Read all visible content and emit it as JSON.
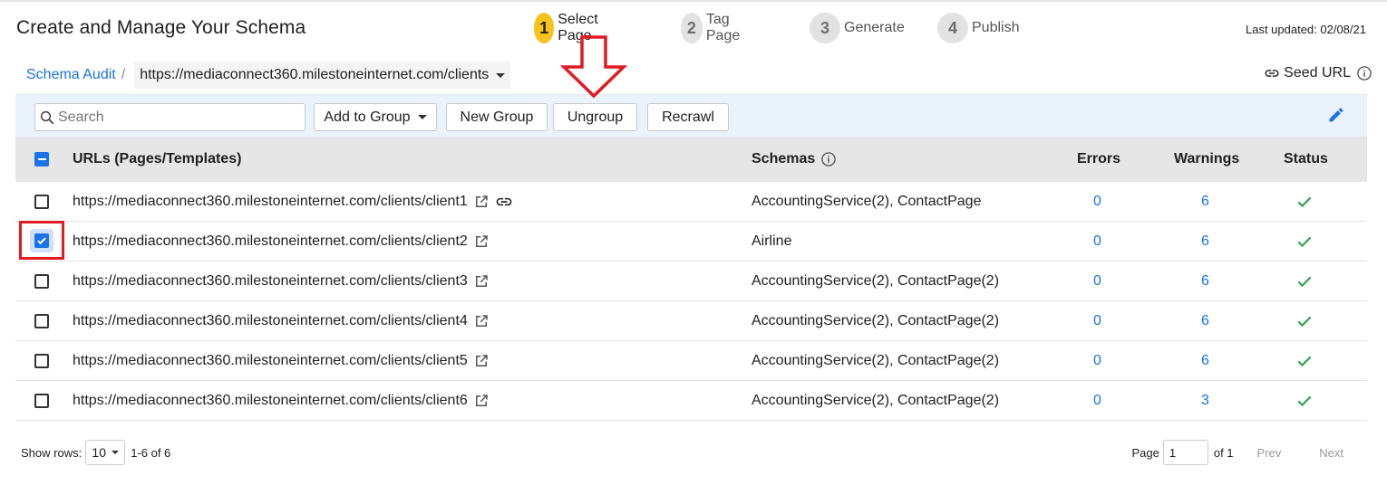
{
  "page": {
    "title": "Create and Manage Your Schema",
    "last_updated": "Last updated: 02/08/21"
  },
  "stepper": [
    {
      "num": "1",
      "label": "Select Page",
      "active": true
    },
    {
      "num": "2",
      "label": "Tag Page",
      "active": false
    },
    {
      "num": "3",
      "label": "Generate",
      "active": false
    },
    {
      "num": "4",
      "label": "Publish",
      "active": false
    }
  ],
  "breadcrumb": {
    "root": "Schema Audit",
    "separator": "/",
    "current_url": "https://mediaconnect360.milestoneinternet.com/clients"
  },
  "seed_url": {
    "label": "Seed URL"
  },
  "toolbar": {
    "search_placeholder": "Search",
    "add_to_group": "Add to Group",
    "new_group": "New Group",
    "ungroup": "Ungroup",
    "recrawl": "Recrawl"
  },
  "table": {
    "headers": {
      "urls": "URLs (Pages/Templates)",
      "schemas": "Schemas",
      "errors": "Errors",
      "warnings": "Warnings",
      "status": "Status"
    },
    "rows": [
      {
        "url": "https://mediaconnect360.milestoneinternet.com/clients/client1",
        "schemas": "AccountingService(2), ContactPage",
        "errors": "0",
        "warnings": "6",
        "checked": false,
        "seed": true,
        "status": "ok"
      },
      {
        "url": "https://mediaconnect360.milestoneinternet.com/clients/client2",
        "schemas": "Airline",
        "errors": "0",
        "warnings": "6",
        "checked": true,
        "seed": false,
        "status": "ok"
      },
      {
        "url": "https://mediaconnect360.milestoneinternet.com/clients/client3",
        "schemas": "AccountingService(2), ContactPage(2)",
        "errors": "0",
        "warnings": "6",
        "checked": false,
        "seed": false,
        "status": "ok"
      },
      {
        "url": "https://mediaconnect360.milestoneinternet.com/clients/client4",
        "schemas": "AccountingService(2), ContactPage(2)",
        "errors": "0",
        "warnings": "6",
        "checked": false,
        "seed": false,
        "status": "ok"
      },
      {
        "url": "https://mediaconnect360.milestoneinternet.com/clients/client5",
        "schemas": "AccountingService(2), ContactPage(2)",
        "errors": "0",
        "warnings": "6",
        "checked": false,
        "seed": false,
        "status": "ok"
      },
      {
        "url": "https://mediaconnect360.milestoneinternet.com/clients/client6",
        "schemas": "AccountingService(2), ContactPage(2)",
        "errors": "0",
        "warnings": "3",
        "checked": false,
        "seed": false,
        "status": "ok"
      }
    ]
  },
  "footer": {
    "show_rows_label": "Show rows:",
    "rows_value": "10",
    "range": "1-6 of 6",
    "page_label": "Page",
    "page_value": "1",
    "of_label": "of 1",
    "prev": "Prev",
    "next": "Next"
  },
  "colors": {
    "accent": "#1a73e8",
    "step_active": "#f7c21c",
    "status_ok": "#2ea44f",
    "annotation": "#e01b22"
  }
}
